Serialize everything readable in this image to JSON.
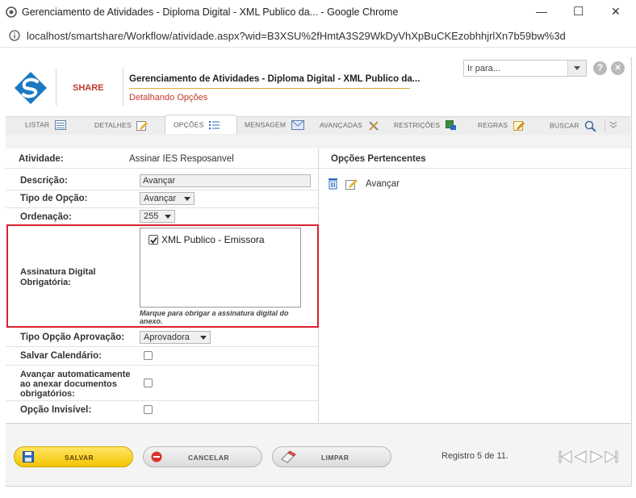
{
  "window": {
    "title": "Gerenciamento de Atividades - Diploma Digital - XML Publico da... - Google Chrome",
    "url": "localhost/smartshare/Workflow/atividade.aspx?wid=B3XSU%2fHmtA3S29WkDyVhXpBuCKEzobhhjrlXn7b59bw%3d",
    "minimize_glyph": "—",
    "maximize_glyph": "☐",
    "close_glyph": "✕"
  },
  "header": {
    "logo_text": "SHARE",
    "title": "Gerenciamento de Atividades - Diploma Digital - XML Publico da...",
    "subtitle": "Detalhando Opções",
    "goto_placeholder": "Ir para...",
    "help_glyph": "?",
    "close_glyph": "✕"
  },
  "tabs": [
    {
      "label": "LISTAR",
      "icon": "list-icon"
    },
    {
      "label": "DETALHES",
      "icon": "edit-icon"
    },
    {
      "label": "OPÇÕES",
      "icon": "options-list-icon",
      "active": true
    },
    {
      "label": "MENSAGEM",
      "icon": "envelope-icon"
    },
    {
      "label": "AVANÇADAS",
      "icon": "tools-icon"
    },
    {
      "label": "RESTRIÇÕES",
      "icon": "restrictions-icon"
    },
    {
      "label": "REGRAS",
      "icon": "rules-icon"
    },
    {
      "label": "BUSCAR",
      "icon": "magnifier-icon"
    }
  ],
  "form": {
    "atividade_label": "Atividade:",
    "atividade_value": "Assinar IES Resposanvel",
    "descricao_label": "Descrição:",
    "descricao_value": "Avançar",
    "tipo_opcao_label": "Tipo de Opção:",
    "tipo_opcao_value": "Avançar",
    "ordenacao_label": "Ordenação:",
    "ordenacao_value": "255",
    "assinatura_label": "Assinatura Digital Obrigatória:",
    "assinatura_item": "XML Publico - Emissora",
    "assinatura_item_checked": true,
    "assinatura_hint": "Marque para obrigar a assinatura digital do anexo.",
    "tipo_aprovacao_label": "Tipo Opção Aprovação:",
    "tipo_aprovacao_value": "Aprovadora",
    "salvar_calendario_label": "Salvar Calendário:",
    "avancar_auto_label": "Avançar automaticamente ao anexar documentos obrigatórios:",
    "opcao_invisivel_label": "Opção Invisível:"
  },
  "right_panel": {
    "title": "Opções Pertencentes",
    "items": [
      {
        "label": "Avançar"
      }
    ]
  },
  "footer": {
    "save_label": "SALVAR",
    "cancel_label": "CANCELAR",
    "clear_label": "LIMPAR",
    "record_text": "Registro 5 de 11."
  },
  "colors": {
    "highlight_border": "#d9232d",
    "save_button": "#f5c400",
    "brand_blue": "#1b79c2",
    "brand_red": "#c0392b"
  }
}
